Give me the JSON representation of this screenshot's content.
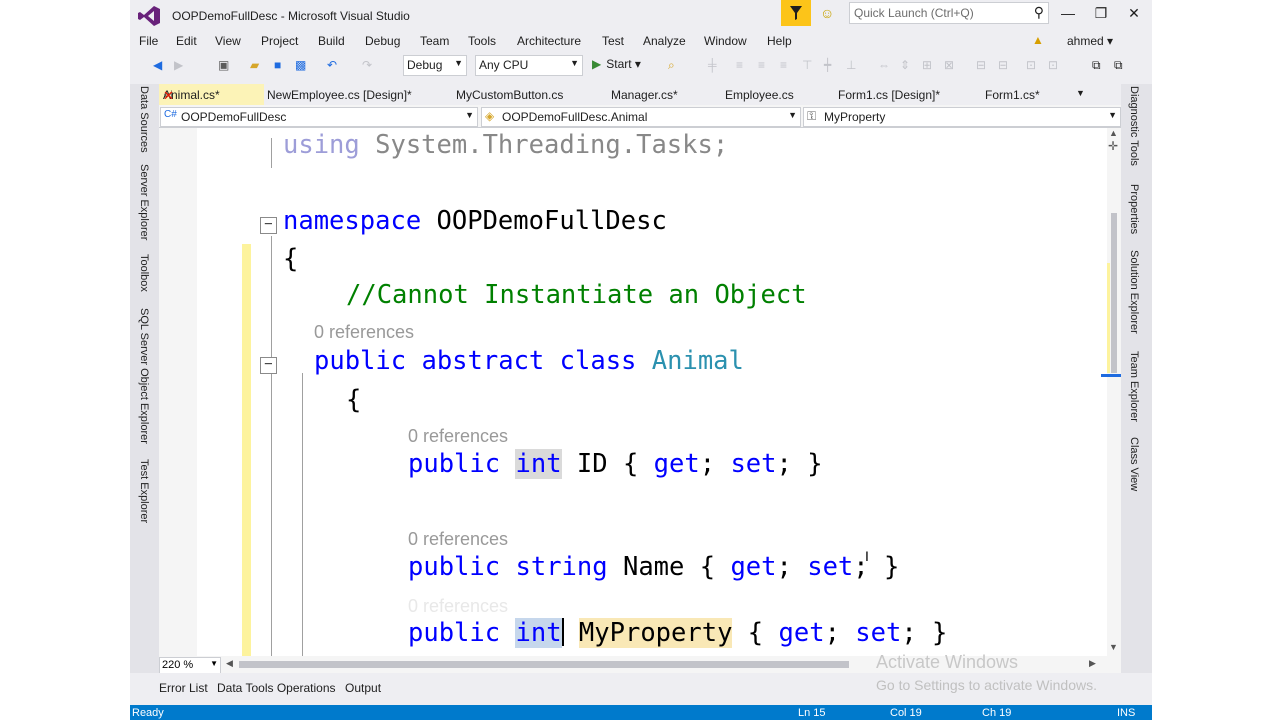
{
  "window": {
    "title": "OOPDemoFullDesc - Microsoft Visual Studio",
    "quick_launch_placeholder": "Quick Launch (Ctrl+Q)",
    "user": "ahmed"
  },
  "menu": [
    "File",
    "Edit",
    "View",
    "Project",
    "Build",
    "Debug",
    "Team",
    "Tools",
    "Architecture",
    "Test",
    "Analyze",
    "Window",
    "Help"
  ],
  "toolbar": {
    "configuration": "Debug",
    "platform": "Any CPU",
    "start_label": "Start"
  },
  "left_tool_tabs": [
    "Data Sources",
    "Server Explorer",
    "Toolbox",
    "SQL Server Object Explorer",
    "Test Explorer"
  ],
  "right_tool_tabs": [
    "Diagnostic Tools",
    "Properties",
    "Solution Explorer",
    "Team Explorer",
    "Class View"
  ],
  "doc_tabs": [
    {
      "label": "Animal.cs*",
      "active": true
    },
    {
      "label": "NewEmployee.cs [Design]*"
    },
    {
      "label": "MyCustomButton.cs"
    },
    {
      "label": "Manager.cs*"
    },
    {
      "label": "Employee.cs"
    },
    {
      "label": "Form1.cs [Design]*"
    },
    {
      "label": "Form1.cs*"
    }
  ],
  "nav": {
    "project": "OOPDemoFullDesc",
    "type": "OOPDemoFullDesc.Animal",
    "member": "MyProperty"
  },
  "code": {
    "using_kw": "using",
    "using_ns": " System.Threading.Tasks;",
    "ns_kw": "namespace",
    "ns_name": " OOPDemoFullDesc",
    "open_brace": "{",
    "comment": "//Cannot Instantiate an Object",
    "refs_label": "0 references",
    "class_mods": "public abstract class ",
    "class_name": "Animal",
    "public_kw": "public",
    "int_kw": "int",
    "string_kw": "string",
    "id_prop": " ID { ",
    "name_prop": " Name { ",
    "myprop": "MyProperty",
    "get_kw": "get",
    "set_kw": "set",
    "semi": ";",
    "close_prop": "; }"
  },
  "editor": {
    "zoom": "220 %"
  },
  "watermark": {
    "line1": "Activate Windows",
    "line2": "Go to Settings to activate Windows."
  },
  "bottom_tabs": [
    "Error List",
    "Data Tools Operations",
    "Output"
  ],
  "status": {
    "state": "Ready",
    "line": "Ln 15",
    "col": "Col 19",
    "ch": "Ch 19",
    "mode": "INS"
  },
  "colors": {
    "accent": "#007acc",
    "keyword": "#0000ff",
    "type": "#2b91af",
    "comment": "#008000",
    "active_tab": "#fcf3b7"
  }
}
